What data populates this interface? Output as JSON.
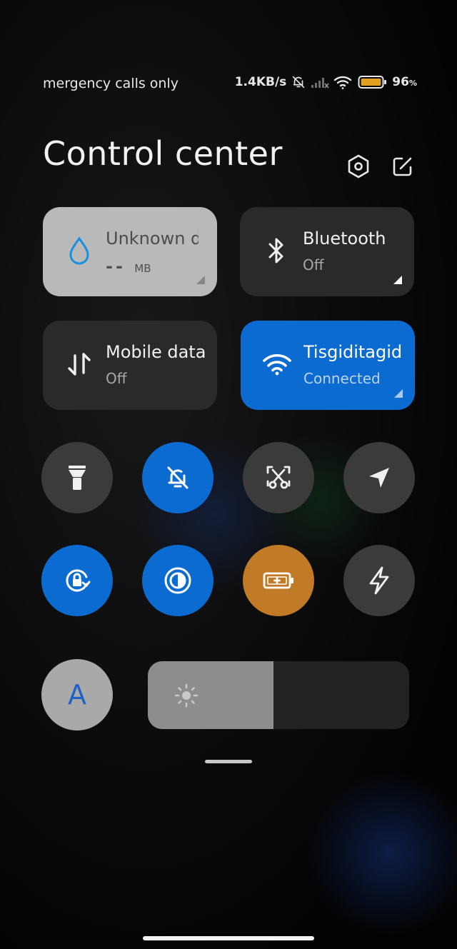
{
  "status_bar": {
    "carrier_text": "mergency calls only",
    "net_speed": "1.4KB/s",
    "battery_percent": "96",
    "battery_unit": "%",
    "icons": [
      "silent-icon",
      "no-signal-icon",
      "wifi-icon",
      "battery-icon"
    ]
  },
  "header": {
    "title": "Control center",
    "icons": [
      "settings-hex-icon",
      "edit-icon"
    ]
  },
  "tiles": [
    {
      "name": "data-usage",
      "title": "Unknown data plan",
      "value": "--",
      "unit": "MB",
      "state": "light",
      "icon": "water-drop-icon"
    },
    {
      "name": "bluetooth",
      "title": "Bluetooth",
      "subtitle": "Off",
      "state": "off",
      "icon": "bluetooth-icon"
    },
    {
      "name": "mobile-data",
      "title": "Mobile data",
      "subtitle": "Off",
      "state": "off",
      "icon": "mobile-data-arrows-icon"
    },
    {
      "name": "wifi",
      "title": "Tisgiditagid",
      "subtitle": "Connected",
      "state": "on",
      "icon": "wifi-icon"
    }
  ],
  "toggles": [
    {
      "name": "flashlight",
      "icon": "flashlight-icon",
      "state": "off"
    },
    {
      "name": "silent",
      "icon": "bell-off-icon",
      "state": "on"
    },
    {
      "name": "screenshot",
      "icon": "scissors-screenshot-icon",
      "state": "off"
    },
    {
      "name": "location",
      "icon": "location-arrow-icon",
      "state": "off"
    },
    {
      "name": "rotation-lock",
      "icon": "rotation-lock-icon",
      "state": "on"
    },
    {
      "name": "reading-mode",
      "icon": "reading-mode-icon",
      "state": "on"
    },
    {
      "name": "battery-saver",
      "icon": "battery-saver-icon",
      "state": "on"
    },
    {
      "name": "ultra-battery",
      "icon": "lightning-icon",
      "state": "off"
    }
  ],
  "auto_font": {
    "label": "A"
  },
  "brightness": {
    "level_percent": 48,
    "icon": "sun-icon"
  },
  "colors": {
    "accent_blue": "#0c6bd1",
    "accent_orange": "#c17a26",
    "tile_dark": "#2a2a2b",
    "tile_light": "#b9b9b9"
  }
}
